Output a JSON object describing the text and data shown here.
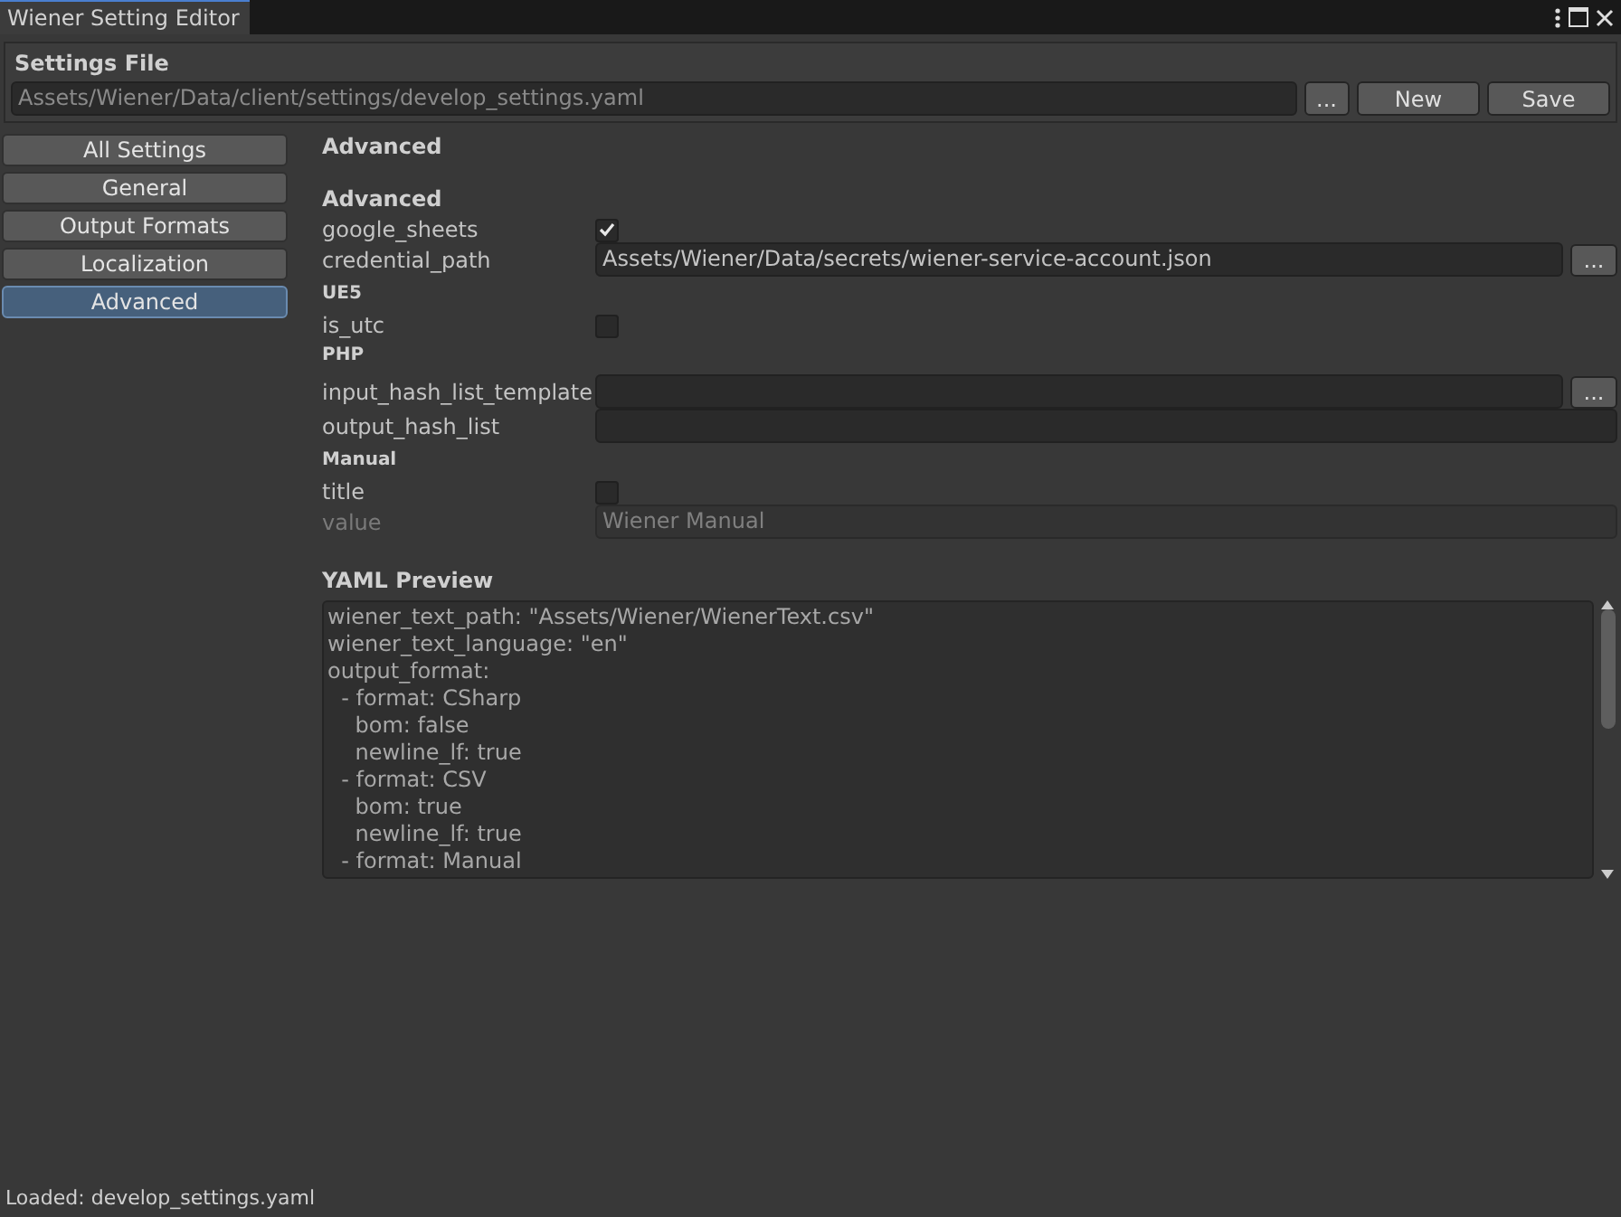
{
  "window": {
    "title": "Wiener Setting Editor"
  },
  "settings_file": {
    "label": "Settings File",
    "path": "Assets/Wiener/Data/client/settings/develop_settings.yaml",
    "buttons": [
      "...",
      "New",
      "Save"
    ]
  },
  "sidebar": {
    "items": [
      {
        "label": "All Settings",
        "selected": false
      },
      {
        "label": "General",
        "selected": false
      },
      {
        "label": "Output Formats",
        "selected": false
      },
      {
        "label": "Localization",
        "selected": false
      },
      {
        "label": "Advanced",
        "selected": true
      }
    ]
  },
  "panel": {
    "title": "Advanced",
    "rows": [
      {
        "kind": "section",
        "label": "Advanced"
      },
      {
        "kind": "checkbox",
        "label": "google_sheets",
        "checked": true
      },
      {
        "kind": "path",
        "label": "credential_path",
        "value": "Assets/Wiener/Data/secrets/wiener-service-account.json",
        "button": "..."
      },
      {
        "kind": "group",
        "label": "UE5"
      },
      {
        "kind": "checkbox",
        "label": "is_utc",
        "checked": false
      },
      {
        "kind": "group",
        "label": "PHP"
      },
      {
        "kind": "path",
        "label": "input_hash_list_template",
        "value": "",
        "button": "..."
      },
      {
        "kind": "text",
        "label": "output_hash_list",
        "value": ""
      },
      {
        "kind": "group",
        "label": "Manual"
      },
      {
        "kind": "checkbox",
        "label": "title",
        "checked": false
      },
      {
        "kind": "text",
        "label": "value",
        "value": "Wiener Manual",
        "disabled": true
      }
    ]
  },
  "yaml_preview": {
    "title": "YAML Preview",
    "lines": [
      "wiener_text_path: \"Assets/Wiener/WienerText.csv\"",
      "wiener_text_language: \"en\"",
      "output_format:",
      "  - format: CSharp",
      "    bom: false",
      "    newline_lf: true",
      "  - format: CSV",
      "    bom: true",
      "    newline_lf: true",
      "  - format: Manual"
    ]
  },
  "status_bar": {
    "text": "Loaded: develop_settings.yaml"
  }
}
